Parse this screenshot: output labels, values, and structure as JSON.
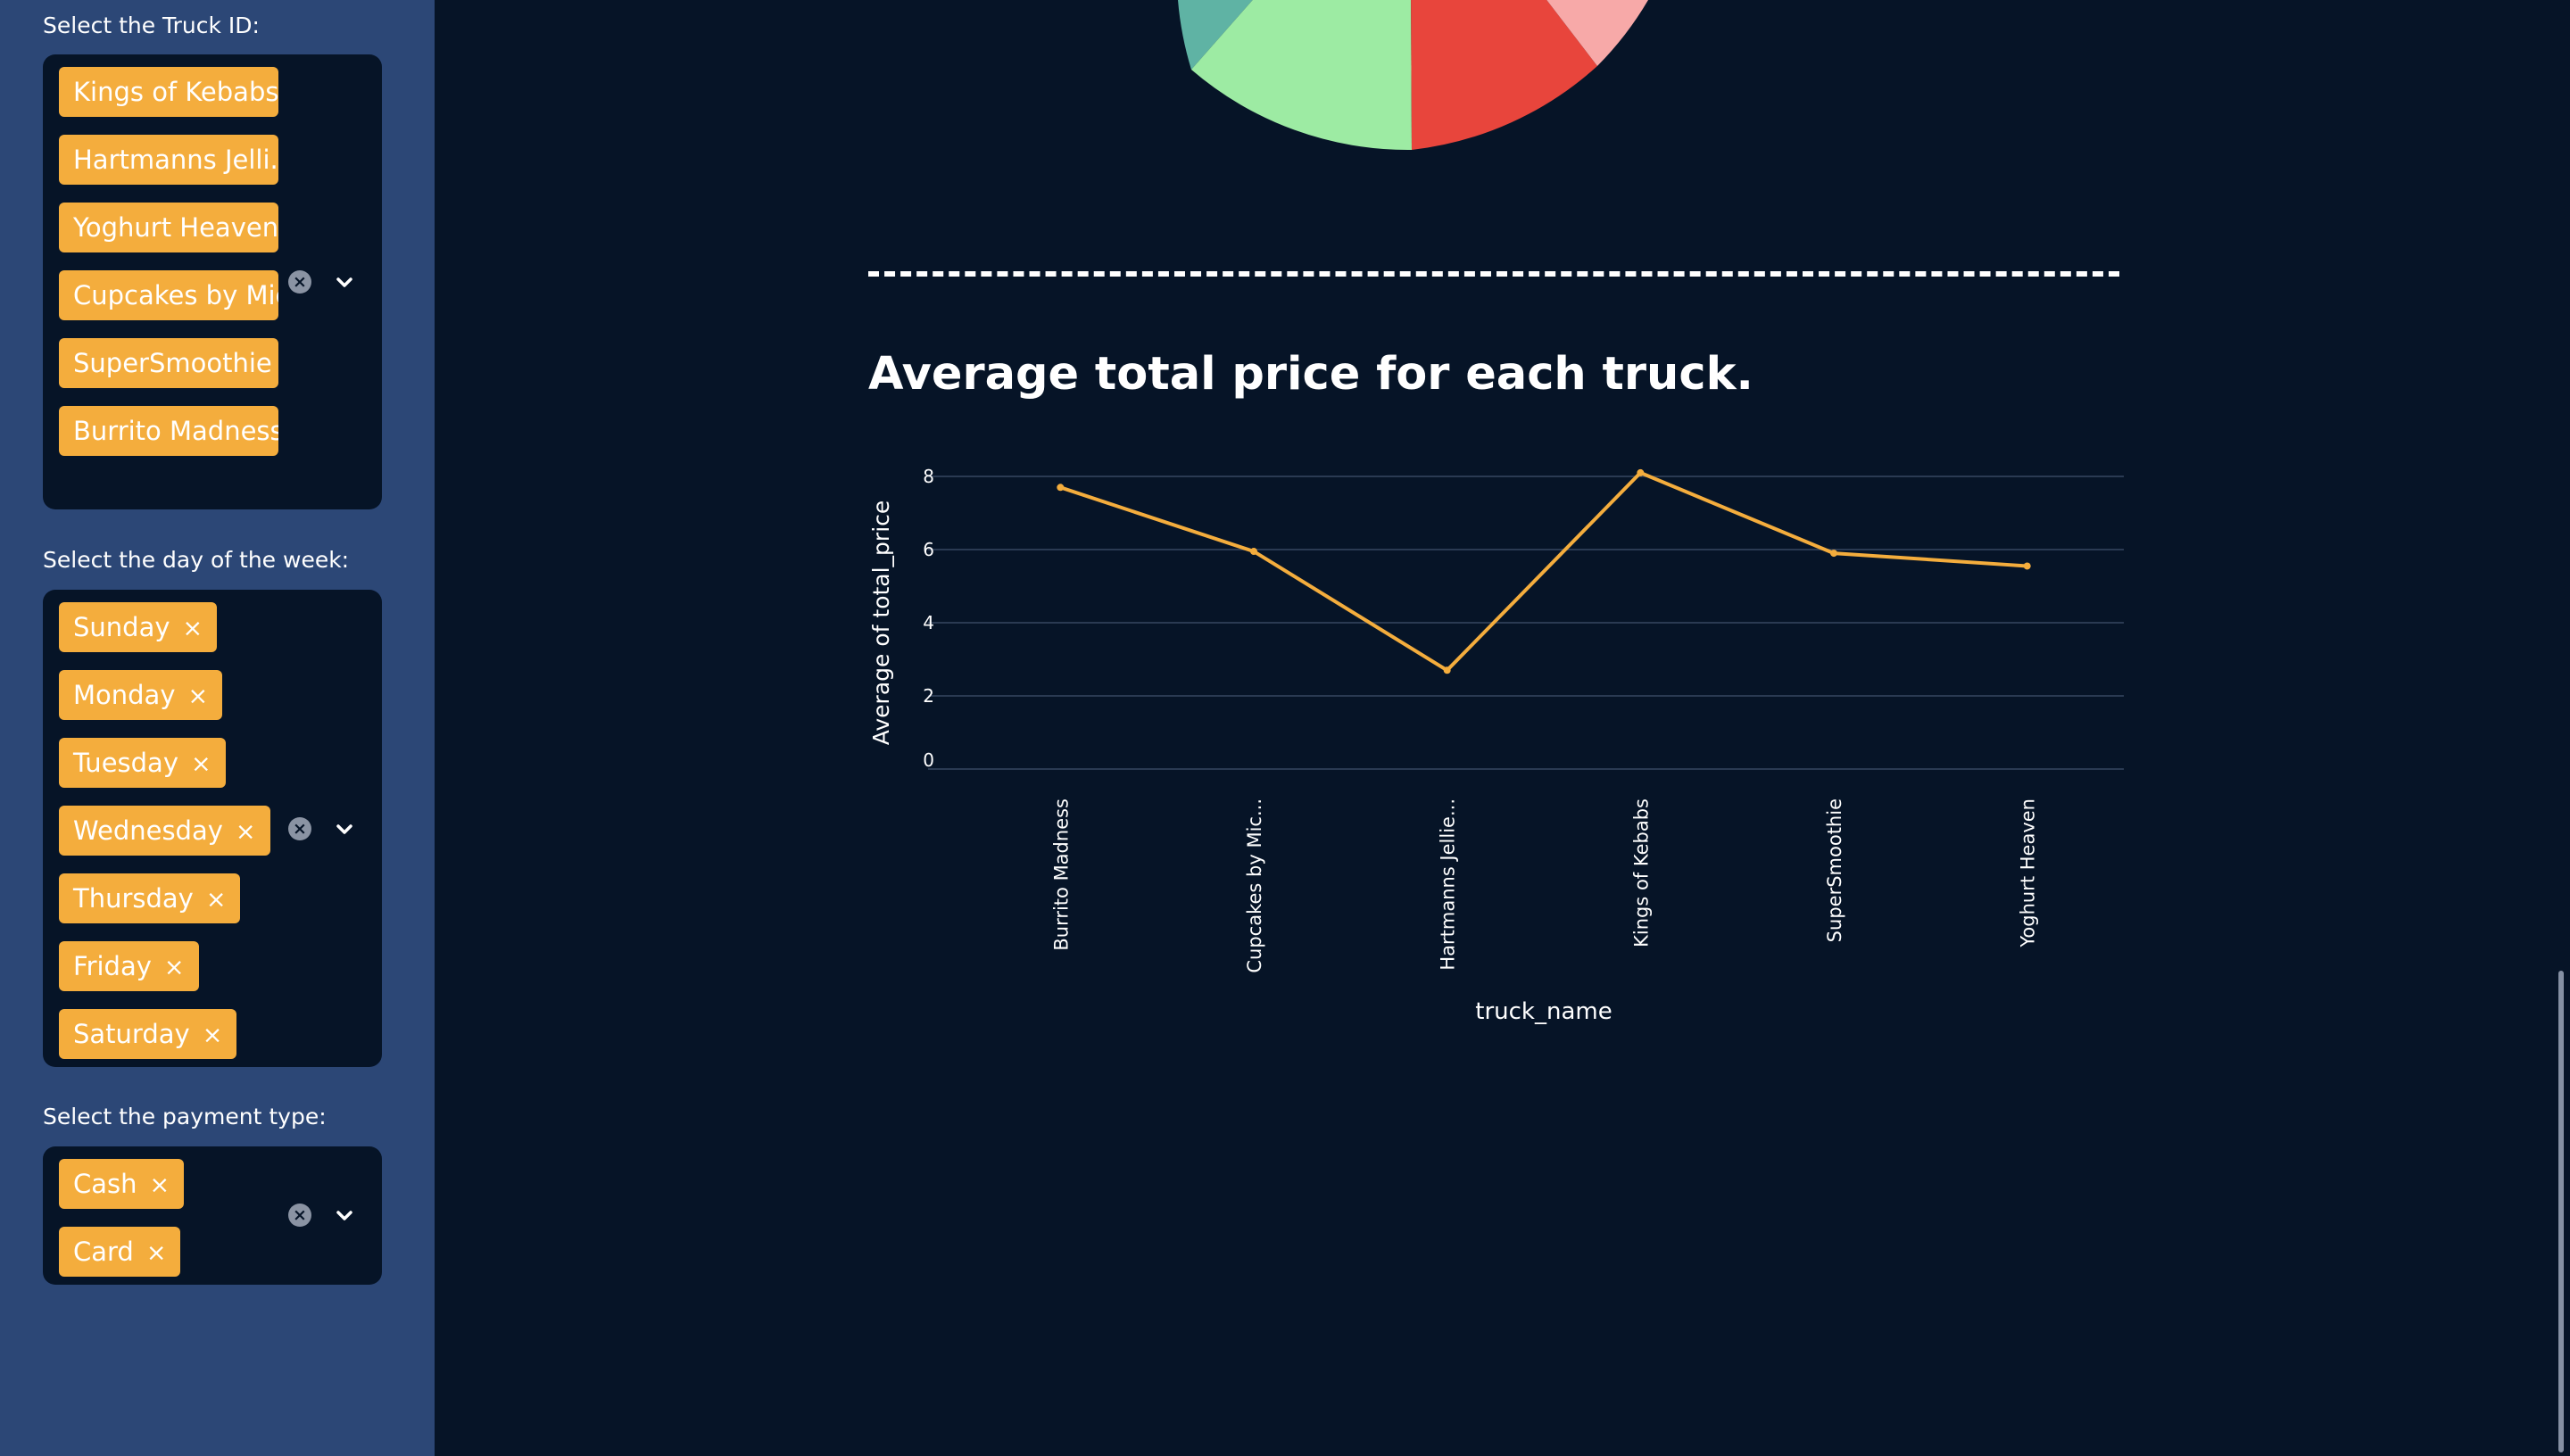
{
  "sidebar": {
    "truck_filter": {
      "label": "Select the Truck ID:",
      "tags": [
        "Kings of Kebabs",
        "Hartmanns Jelli...",
        "Yoghurt Heaven",
        "Cupcakes by Mic...",
        "SuperSmoothie",
        "Burrito Madness"
      ],
      "remove_symbol": "×",
      "clear_symbol": "×"
    },
    "day_filter": {
      "label": "Select the day of the week:",
      "tags": [
        "Sunday",
        "Monday",
        "Tuesday",
        "Wednesday",
        "Thursday",
        "Friday",
        "Saturday"
      ],
      "remove_symbol": "×",
      "clear_symbol": "×"
    },
    "payment_filter": {
      "label": "Select the payment type:",
      "tags": [
        "Cash",
        "Card"
      ],
      "remove_symbol": "×",
      "clear_symbol": "×"
    }
  },
  "main": {
    "divider": "--------------------------------------------------------------------------------",
    "heading": "Average total price for each truck."
  },
  "colors": {
    "sidebar_bg": "#2c4776",
    "main_bg": "#061427",
    "tag_bg": "#f4ad3d",
    "line": "#f4ad3d",
    "pie_slices": [
      "#5fb3a4",
      "#9deba3",
      "#e8453c",
      "#f7a9a8"
    ]
  },
  "chart_data": {
    "type": "line",
    "title": "Average total price for each truck.",
    "xlabel": "truck_name",
    "ylabel": "Average of total_price",
    "categories": [
      "Burrito Madness",
      "Cupcakes by Mic...",
      "Hartmanns Jellie...",
      "Kings of Kebabs",
      "SuperSmoothie",
      "Yoghurt Heaven"
    ],
    "values": [
      7.7,
      5.95,
      2.7,
      8.1,
      5.9,
      5.55
    ],
    "yticks": [
      "0",
      "2",
      "4",
      "6",
      "8"
    ],
    "ylim": [
      0,
      8
    ],
    "grid": true,
    "line_color": "#f4ad3d"
  }
}
